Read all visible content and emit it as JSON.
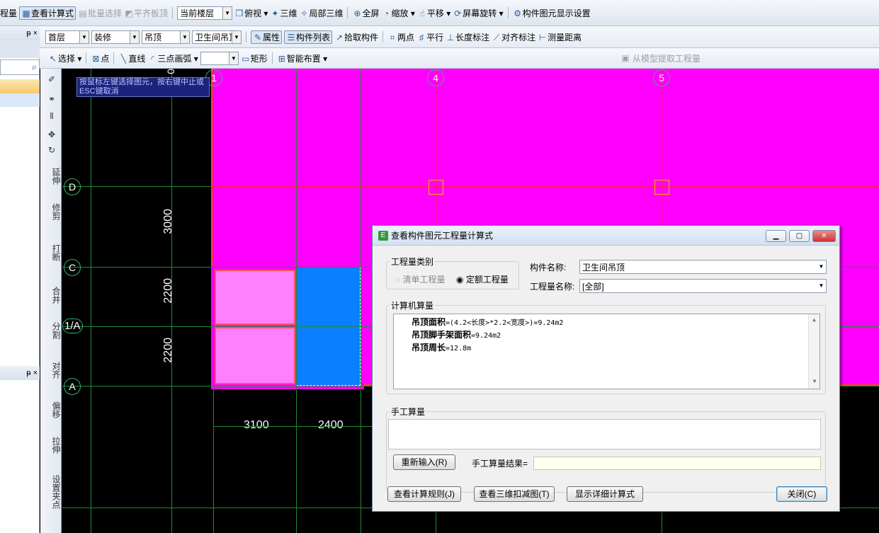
{
  "toolbar1": {
    "cut_label": "程量",
    "view_formula": "查看计算式",
    "batch_select": "批量选择",
    "flush_slab": "平齐板顶",
    "floor_select": "当前楼层",
    "top_view": "俯视",
    "view_3d": "三维",
    "local_3d": "局部三维",
    "fullscreen": "全屏",
    "zoom": "缩放",
    "pan": "平移",
    "rotate": "屏幕旋转",
    "display_settings": "构件图元显示设置"
  },
  "toolbar2": {
    "floor": "首层",
    "category": "装修",
    "type": "吊顶",
    "component": "卫生间吊顶",
    "properties": "属性",
    "component_list": "构件列表",
    "pick": "拾取构件",
    "two_points": "两点",
    "parallel": "平行",
    "length_dim": "长度标注",
    "align_dim": "对齐标注",
    "measure": "测量距离"
  },
  "toolbar3": {
    "select": "选择",
    "point": "点",
    "line": "直线",
    "arc": "三点画弧",
    "rect": "矩形",
    "smart": "智能布置",
    "extract": "从模型提取工程量"
  },
  "left_panel": {
    "pin1": "ᵽ ×",
    "pin2": "ᵽ ×"
  },
  "side_tools": [
    "延伸",
    "修剪",
    "打断",
    "合并",
    "分割",
    "对齐",
    "偏移",
    "拉伸",
    "设置夹点"
  ],
  "canvas": {
    "hint": "按鼠标左键选择图元，按右键中止或ESC键取消",
    "axes_h": [
      "1",
      "4",
      "5"
    ],
    "axes_v": [
      "D",
      "C",
      "1/A",
      "A"
    ],
    "dims_v": [
      "3000",
      "2200",
      "2200"
    ],
    "dims_h": [
      "3100",
      "2400"
    ],
    "top_zero": "0"
  },
  "dialog": {
    "title": "查看构件图元工程量计算式",
    "qty_type_label": "工程量类别",
    "radio_list": "清单工程量",
    "radio_quota": "定额工程量",
    "comp_name_label": "构件名称:",
    "comp_name_value": "卫生间吊顶",
    "qty_name_label": "工程量名称:",
    "qty_name_value": "[全部]",
    "computer_label": "计算机算量",
    "formulas": [
      {
        "name": "吊顶面积",
        "expr": "=(4.2<长度>*2.2<宽度>)=9.24m2"
      },
      {
        "name": "吊顶脚手架面积",
        "expr": "=9.24m2"
      },
      {
        "name": "吊顶周长",
        "expr": "=12.8m"
      }
    ],
    "manual_label": "手工算量",
    "reinput": "重新输入(R)",
    "manual_result_label": "手工算量结果=",
    "view_rules": "查看计算规则(J)",
    "view_3d_deduct": "查看三维扣减图(T)",
    "show_detail": "显示详细计算式",
    "close": "关闭(C)"
  },
  "colors": {
    "magenta": "#ff00ff",
    "pink": "#ff80ff",
    "blue": "#0a7fff",
    "grid": "#1f8a32",
    "red_line": "#ff2040"
  }
}
